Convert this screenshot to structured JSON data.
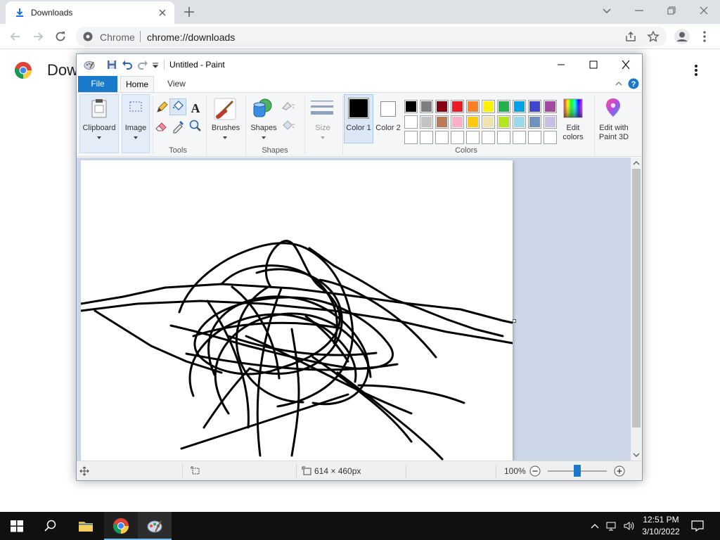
{
  "browser": {
    "tab_title": "Downloads",
    "site_name": "Chrome",
    "url": "chrome://downloads",
    "page_heading": "Dow"
  },
  "paint": {
    "title": "Untitled - Paint",
    "tabs": [
      "File",
      "Home",
      "View"
    ],
    "groups": {
      "clipboard": "Clipboard",
      "image": "Image",
      "tools": "Tools",
      "brushes": "Brushes",
      "shapes": "Shapes",
      "shapes_group": "Shapes",
      "size": "Size",
      "color1": "Color 1",
      "color2": "Color 2",
      "colors_group": "Colors",
      "edit_colors": "Edit colors",
      "edit_3d": "Edit with Paint 3D"
    },
    "palette_row1": [
      "#000000",
      "#7f7f7f",
      "#880015",
      "#ed1c24",
      "#ff7f27",
      "#fff200",
      "#22b14c",
      "#00a2e8",
      "#3f48cc",
      "#a349a4"
    ],
    "palette_row2": [
      "#ffffff",
      "#c3c3c3",
      "#b97a57",
      "#ffaec9",
      "#ffc90e",
      "#efe4b0",
      "#b5e61d",
      "#99d9ea",
      "#7092be",
      "#c8bfe7"
    ],
    "color1": "#000000",
    "color2": "#ffffff",
    "status": {
      "canvas_size": "614 × 460px",
      "zoom": "100%",
      "zoom_level": 0.5
    }
  },
  "taskbar": {
    "time": "12:51 PM",
    "date": "3/10/2022"
  }
}
